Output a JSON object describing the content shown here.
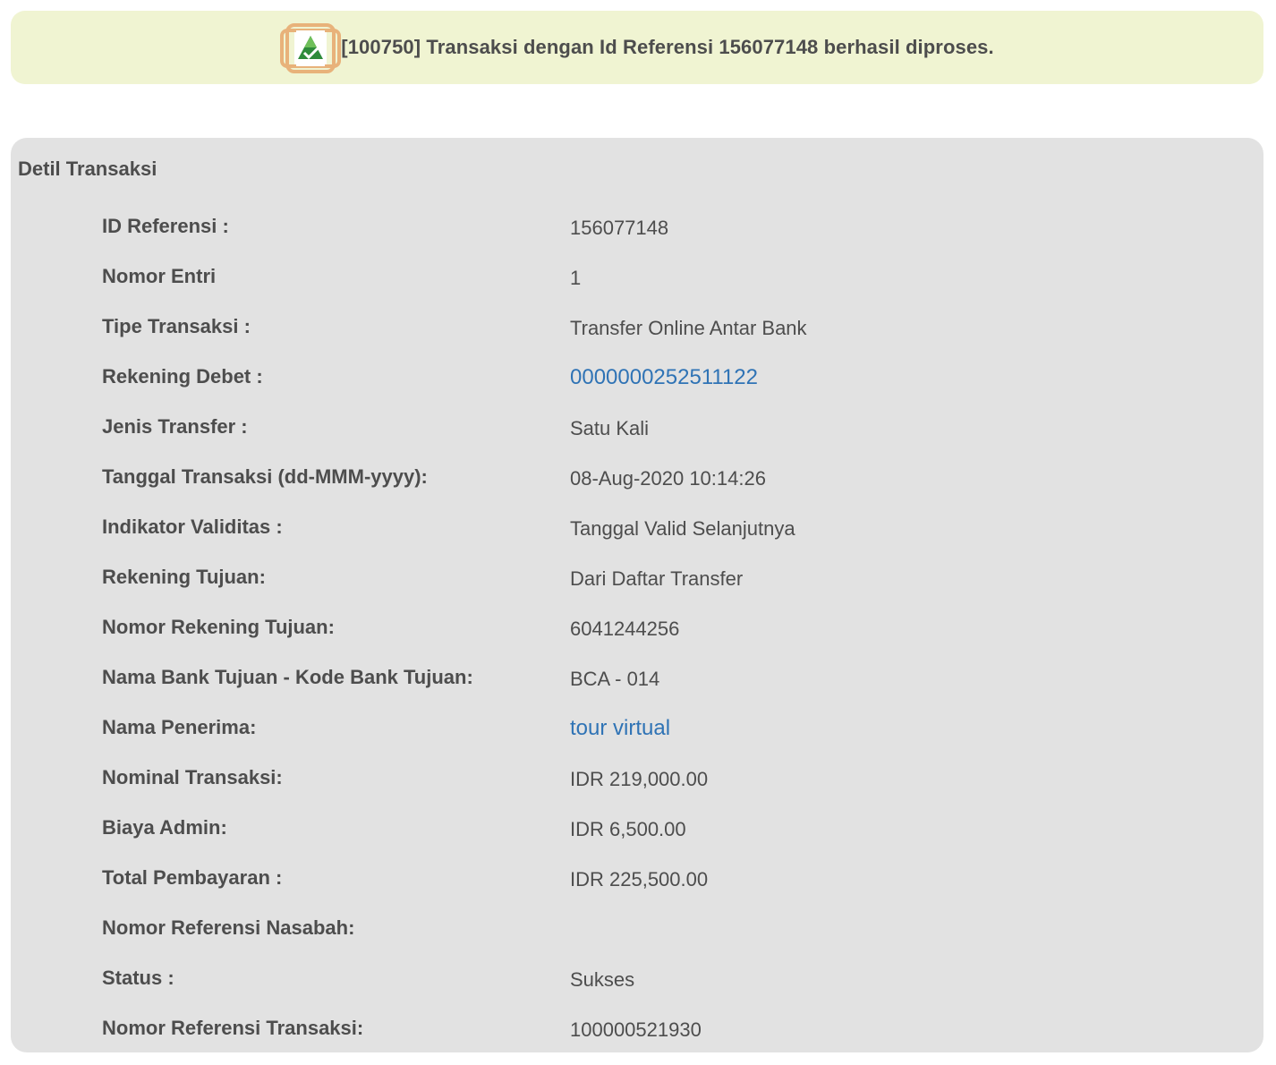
{
  "banner": {
    "icon": "success-check-icon",
    "message": "[100750] Transaksi dengan Id Referensi 156077148 berhasil diproses.",
    "colors": {
      "background": "#f0f4d2",
      "icon_border": "#e8b27a",
      "icon_fill": "#2e8b3a"
    }
  },
  "panel": {
    "title": "Detil Transaksi",
    "background": "#e2e2e2",
    "rows": [
      {
        "label": "ID Referensi :",
        "value": "156077148"
      },
      {
        "label": "Nomor Entri",
        "value": "1"
      },
      {
        "label": "Tipe Transaksi :",
        "value": "Transfer Online Antar Bank"
      },
      {
        "label": "Rekening Debet :",
        "value": "0000000252511122"
      },
      {
        "label": "Jenis Transfer :",
        "value": "Satu Kali"
      },
      {
        "label": "Tanggal Transaksi (dd-MMM-yyyy):",
        "value": "08-Aug-2020 10:14:26"
      },
      {
        "label": "Indikator Validitas :",
        "value": "Tanggal Valid Selanjutnya"
      },
      {
        "label": "Rekening Tujuan:",
        "value": "Dari Daftar Transfer"
      },
      {
        "label": "Nomor Rekening Tujuan:",
        "value": "6041244256"
      },
      {
        "label": "Nama Bank Tujuan - Kode Bank Tujuan:",
        "value": "BCA - 014"
      },
      {
        "label": "Nama Penerima:",
        "value": "tour virtual"
      },
      {
        "label": "Nominal Transaksi:",
        "value": "IDR 219,000.00"
      },
      {
        "label": "Biaya Admin:",
        "value": "IDR 6,500.00"
      },
      {
        "label": "Total Pembayaran :",
        "value": "IDR 225,500.00"
      },
      {
        "label": "Nomor Referensi Nasabah:",
        "value": ""
      },
      {
        "label": "Status :",
        "value": "Sukses"
      },
      {
        "label": "Nomor Referensi Transaksi:",
        "value": "100000521930"
      }
    ],
    "link_color": "#2f73b5"
  }
}
